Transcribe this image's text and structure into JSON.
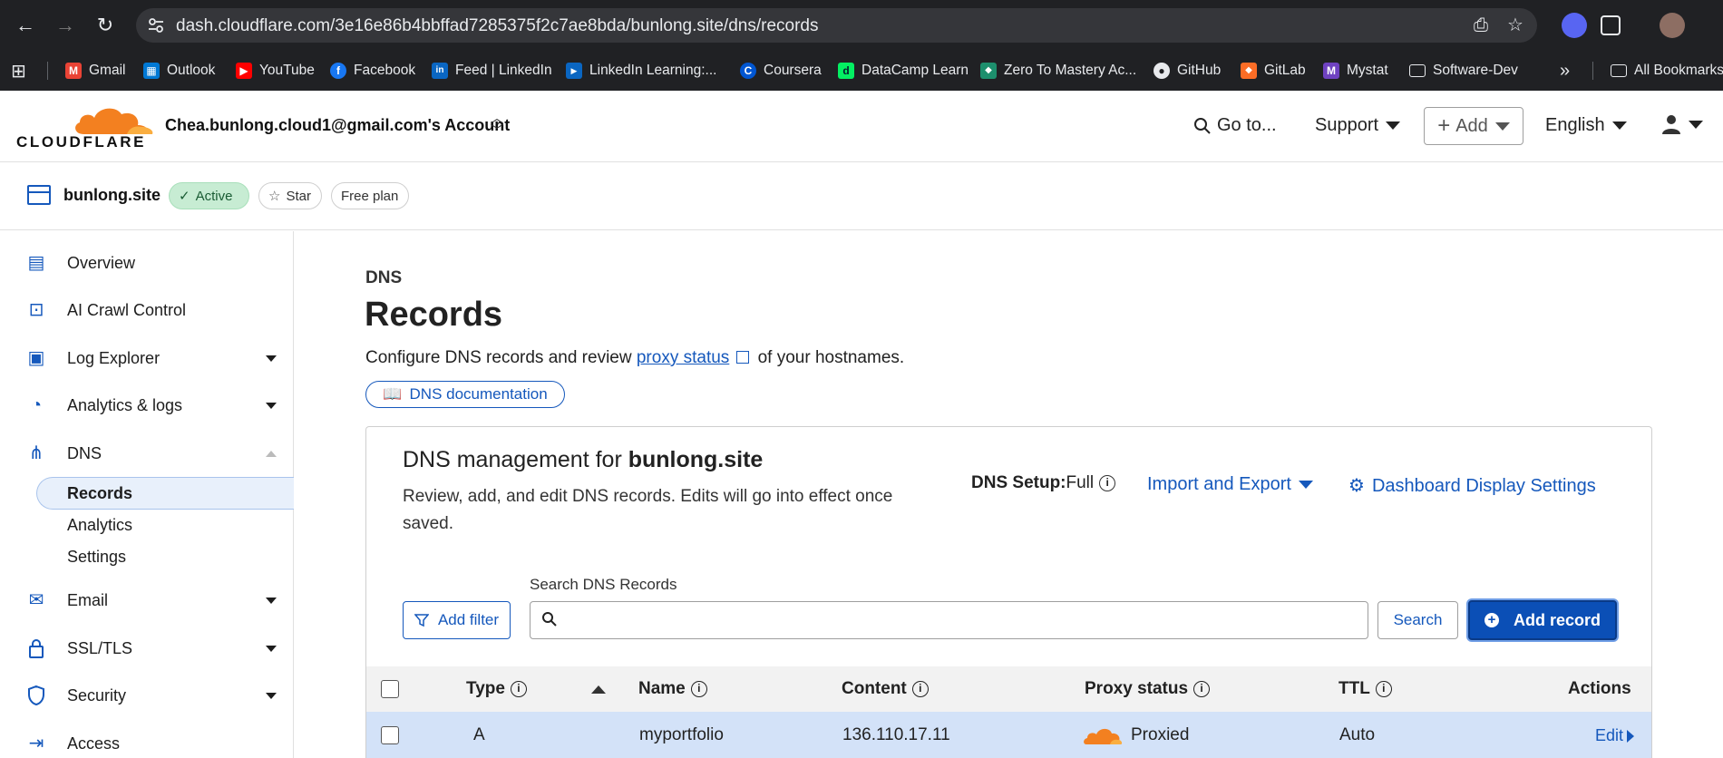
{
  "browser": {
    "url": "dash.cloudflare.com/3e16e86b4bbffad7285375f2c7ae8bda/bunlong.site/dns/records",
    "bookmarks": [
      {
        "label": "Gmail",
        "color": "#ea4335",
        "glyph": "M"
      },
      {
        "label": "Outlook",
        "color": "#0078d4",
        "glyph": "▦"
      },
      {
        "label": "YouTube",
        "color": "#ff0000",
        "glyph": "▶"
      },
      {
        "label": "Facebook",
        "color": "#1877f2",
        "glyph": "f"
      },
      {
        "label": "Feed | LinkedIn",
        "color": "#0a66c2",
        "glyph": "in"
      },
      {
        "label": "LinkedIn Learning:...",
        "color": "#0a66c2",
        "glyph": "▶"
      },
      {
        "label": "Coursera",
        "color": "#0056d2",
        "glyph": "C"
      },
      {
        "label": "DataCamp Learn",
        "color": "#03ef62",
        "glyph": "d"
      },
      {
        "label": "Zero To Mastery Ac...",
        "color": "#e83e8c",
        "glyph": "◆"
      },
      {
        "label": "GitHub",
        "color": "#444444",
        "glyph": "●"
      },
      {
        "label": "GitLab",
        "color": "#fc6d26",
        "glyph": "◆"
      },
      {
        "label": "Mystat",
        "color": "#6f42c1",
        "glyph": "M"
      },
      {
        "label": "Software-Dev",
        "color": "#202124",
        "glyph": "▭"
      }
    ],
    "bookmarks_overflow": "»",
    "all_bookmarks": "All Bookmarks"
  },
  "header": {
    "logo_text": "CLOUDFLARE",
    "account": "Chea.bunlong.cloud1@gmail.com's Account",
    "goto": "Go to...",
    "support": "Support",
    "add": "Add",
    "language": "English"
  },
  "zone": {
    "name": "bunlong.site",
    "status": "Active",
    "star": "Star",
    "plan": "Free plan"
  },
  "sidebar": {
    "items": [
      {
        "label": "Overview",
        "icon": "📋"
      },
      {
        "label": "AI Crawl Control",
        "icon": "🤖"
      },
      {
        "label": "Log Explorer",
        "icon": "🗎"
      },
      {
        "label": "Analytics & logs",
        "icon": "◔"
      },
      {
        "label": "DNS",
        "icon": "⧉"
      },
      {
        "label": "Email",
        "icon": "✉"
      },
      {
        "label": "SSL/TLS",
        "icon": "🔒"
      },
      {
        "label": "Security",
        "icon": "🛡"
      },
      {
        "label": "Access",
        "icon": "↪"
      }
    ],
    "dns_sub": [
      "Records",
      "Analytics",
      "Settings"
    ]
  },
  "page": {
    "crumb": "DNS",
    "title": "Records",
    "desc_before": "Configure DNS records and review ",
    "desc_link": "proxy status",
    "desc_after": " of your hostnames.",
    "doc_button": "DNS documentation"
  },
  "card": {
    "title_prefix": "DNS management for ",
    "title_domain": "bunlong.site",
    "description": "Review, add, and edit DNS records. Edits will go into effect once saved.",
    "setup_label": "DNS Setup:",
    "setup_value": "Full",
    "import_export": "Import and Export",
    "display_settings": "Dashboard Display Settings",
    "search_label": "Search DNS Records",
    "search_placeholder": "",
    "add_filter": "Add filter",
    "search_button": "Search",
    "add_record": "Add record"
  },
  "table": {
    "headers": {
      "type": "Type",
      "name": "Name",
      "content": "Content",
      "proxy": "Proxy status",
      "ttl": "TTL",
      "actions": "Actions"
    },
    "rows": [
      {
        "type": "A",
        "name": "myportfolio",
        "content": "136.110.17.11",
        "proxy": "Proxied",
        "ttl": "Auto",
        "action": "Edit"
      }
    ]
  },
  "colors": {
    "accent": "#1558bc",
    "primary_button": "#0b4fb6",
    "cloudflare_orange": "#f38020",
    "active_green": "#c7ecd3",
    "row_selected": "#d3e2f8"
  }
}
